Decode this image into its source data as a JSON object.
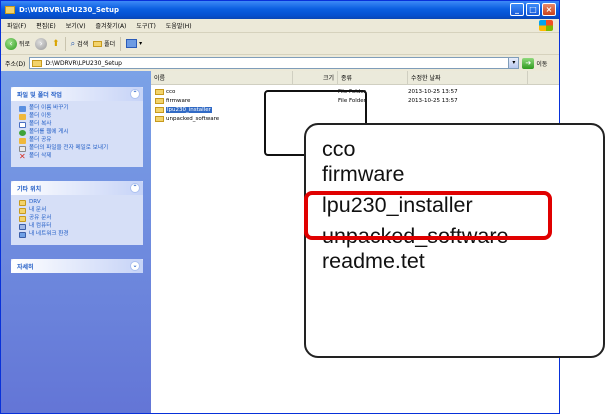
{
  "window": {
    "title": "D:\\WDRVR\\LPU230_Setup"
  },
  "menu": [
    "파일(F)",
    "편집(E)",
    "보기(V)",
    "즐겨찾기(A)",
    "도구(T)",
    "도움말(H)"
  ],
  "toolbar": {
    "back": "뒤로",
    "search": "검색",
    "folders": "폴더"
  },
  "address": {
    "label": "주소(D)",
    "path": "D:\\WDRVR\\LPU230_Setup",
    "go": "이동"
  },
  "tasks": {
    "heading": "파일 및 폴더 작업",
    "items": [
      "폴더 이름 바꾸기",
      "폴더 이동",
      "폴더 복사",
      "폴더를 웹에 게시",
      "폴더 공유",
      "폴더의 파일을 전자 메일로 보내기",
      "폴더 삭제"
    ]
  },
  "places": {
    "heading": "기타 위치",
    "items": [
      "DRV",
      "내 문서",
      "공유 문서",
      "내 컴퓨터",
      "내 네트워크 환경"
    ]
  },
  "details": {
    "heading": "자세히"
  },
  "columns": {
    "name": "이름",
    "size": "크기",
    "type": "종류",
    "modified": "수정한 날짜"
  },
  "files": [
    {
      "name": "cco",
      "type": "File Folder",
      "date": "2013-10-25 13:57",
      "selected": false
    },
    {
      "name": "firmware",
      "type": "File Folder",
      "date": "2013-10-25 13:57",
      "selected": false
    },
    {
      "name": "lpu230_installer",
      "type": "",
      "date": "",
      "selected": true
    },
    {
      "name": "unpacked_software",
      "type": "",
      "date": "",
      "selected": false
    }
  ],
  "callout": {
    "lines": [
      "cco",
      "firmware",
      "lpu230_installer",
      "unpacked_software",
      "readme.tet"
    ],
    "highlight_color": "#e00000"
  }
}
